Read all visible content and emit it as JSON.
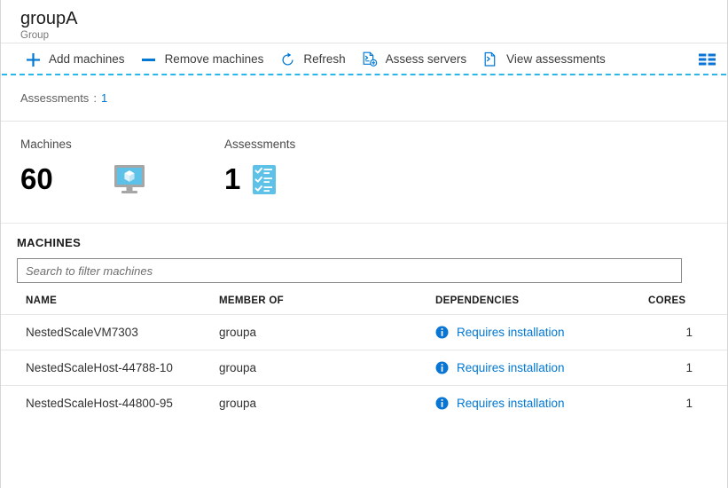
{
  "header": {
    "title": "groupA",
    "subtitle": "Group"
  },
  "commandbar": {
    "items": [
      {
        "label": "Add machines",
        "icon": "plus-icon"
      },
      {
        "label": "Remove machines",
        "icon": "minus-icon"
      },
      {
        "label": "Refresh",
        "icon": "refresh-icon"
      },
      {
        "label": "Assess servers",
        "icon": "assess-servers-icon"
      },
      {
        "label": "View assessments",
        "icon": "view-assessments-icon"
      }
    ],
    "grid_icon": "grid-columns-icon"
  },
  "filters": {
    "label": "Assessments",
    "separator": ":",
    "value": "1"
  },
  "stats": [
    {
      "caption": "Machines",
      "value": "60",
      "icon": "server-monitor-icon"
    },
    {
      "caption": "Assessments",
      "value": "1",
      "icon": "checklist-icon"
    }
  ],
  "machines": {
    "section_title": "MACHINES",
    "search_placeholder": "Search to filter machines",
    "search_value": "",
    "columns": [
      "NAME",
      "MEMBER OF",
      "DEPENDENCIES",
      "CORES"
    ],
    "rows": [
      {
        "name": "NestedScaleVM7303",
        "member_of": "groupa",
        "dependencies": "Requires installation",
        "dependencies_icon": "info-icon",
        "cores": "1"
      },
      {
        "name": "NestedScaleHost-44788-10",
        "member_of": "groupa",
        "dependencies": "Requires installation",
        "dependencies_icon": "info-icon",
        "cores": "1"
      },
      {
        "name": "NestedScaleHost-44800-95",
        "member_of": "groupa",
        "dependencies": "Requires installation",
        "dependencies_icon": "info-icon",
        "cores": "1"
      }
    ]
  },
  "colors": {
    "accent": "#0078d4",
    "focus_dashed": "#29b6e8",
    "icon_light_blue": "#5ec2e8",
    "text_primary": "#1b1b1b",
    "text_secondary": "#767676"
  }
}
